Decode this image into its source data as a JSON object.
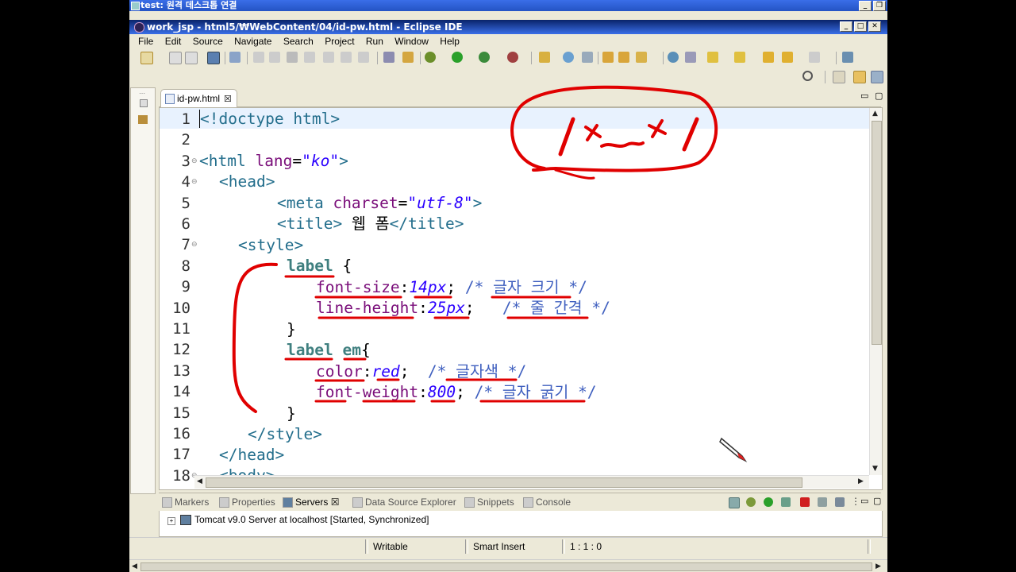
{
  "remote_title": "test: 원격 데스크톱 연결",
  "window_title": "work_jsp - html5/₩WebContent/04/id-pw.html - Eclipse IDE",
  "menu": [
    "File",
    "Edit",
    "Source",
    "Navigate",
    "Search",
    "Project",
    "Run",
    "Window",
    "Help"
  ],
  "editor_tab": {
    "label": "id-pw.html",
    "close": "☒"
  },
  "code_lines": [
    {
      "n": "1",
      "fold": ""
    },
    {
      "n": "2",
      "fold": ""
    },
    {
      "n": "3",
      "fold": "⊖"
    },
    {
      "n": "4",
      "fold": "⊖"
    },
    {
      "n": "5",
      "fold": ""
    },
    {
      "n": "6",
      "fold": ""
    },
    {
      "n": "7",
      "fold": "⊖"
    },
    {
      "n": "8",
      "fold": ""
    },
    {
      "n": "9",
      "fold": ""
    },
    {
      "n": "10",
      "fold": ""
    },
    {
      "n": "11",
      "fold": ""
    },
    {
      "n": "12",
      "fold": ""
    },
    {
      "n": "13",
      "fold": ""
    },
    {
      "n": "14",
      "fold": ""
    },
    {
      "n": "15",
      "fold": ""
    },
    {
      "n": "16",
      "fold": ""
    },
    {
      "n": "17",
      "fold": ""
    },
    {
      "n": "18",
      "fold": "⊖"
    }
  ],
  "code": {
    "l1": "<!doctype html>",
    "l3_open": "<html ",
    "l3_attr": "lang",
    "l3_eq": "=",
    "l3_val": "\"ko\"",
    "l3_close": ">",
    "l4": "<head>",
    "l5_open": "<meta ",
    "l5_attr": "charset",
    "l5_eq": "=",
    "l5_val": "\"utf-8\"",
    "l5_close": ">",
    "l6_open": "<title>",
    "l6_text": " 웹 폼",
    "l6_close": "</title>",
    "l7": "<style>",
    "l8_sel": "label",
    "l8_rest": " {",
    "l9_prop": "font-size",
    "l9_colon": ":",
    "l9_val": "14px",
    "l9_semi": "; ",
    "l9_cmt": "/* 글자 크기 */",
    "l10_prop": "line-height",
    "l10_colon": ":",
    "l10_val": "25px",
    "l10_semi": ";   ",
    "l10_cmt": "/* 줄 간격 */",
    "l11": "}",
    "l12_sel1": "label",
    "l12_sp": " ",
    "l12_sel2": "em",
    "l12_rest": "{",
    "l13_prop": "color",
    "l13_colon": ":",
    "l13_val": "red",
    "l13_semi": ";  ",
    "l13_cmt": "/* 글자색 */",
    "l14_prop": "font-weight",
    "l14_colon": ":",
    "l14_val": "800",
    "l14_semi": "; ",
    "l14_cmt": "/* 글자 굵기 */",
    "l15": "}",
    "l16": "</style>",
    "l17": "</head>",
    "l18": "<body>"
  },
  "bottom_tabs": [
    "Markers",
    "Properties",
    "Servers",
    "Data Source Explorer",
    "Snippets",
    "Console"
  ],
  "active_bottom_tab": "Servers",
  "server_row": "Tomcat v9.0 Server at localhost  [Started, Synchronized]",
  "status": {
    "writable": "Writable",
    "insert": "Smart Insert",
    "position": "1 : 1 : 0"
  },
  "colors": {
    "annotation": "#e00000",
    "tag": "#236e8c",
    "comment": "#3f5fbf",
    "value": "#2a00ff"
  }
}
